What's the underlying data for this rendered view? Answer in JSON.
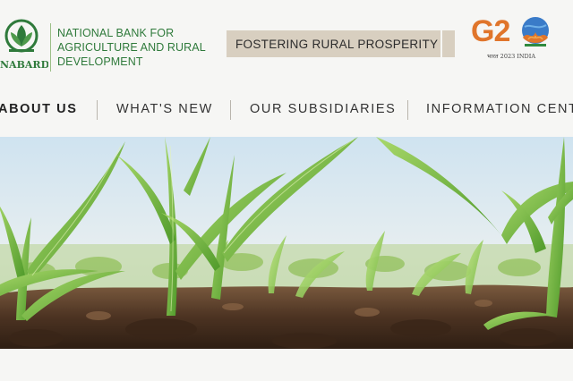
{
  "header": {
    "logo_alt": "NABARD",
    "org_name_lines": [
      "NATIONAL BANK FOR",
      "AGRICULTURE AND RURAL",
      "DEVELOPMENT"
    ],
    "tagline": "FOSTERING RURAL PROSPERITY",
    "g20": {
      "mark": "G20",
      "subtitle": "भारत 2023 INDIA"
    }
  },
  "nav": {
    "items": [
      {
        "label": "ABOUT US",
        "active": true
      },
      {
        "label": "WHAT'S NEW",
        "active": false
      },
      {
        "label": "OUR SUBSIDIARIES",
        "active": false
      },
      {
        "label": "INFORMATION CENTRE",
        "active": false
      }
    ]
  },
  "hero": {
    "image_subject": "corn-seedlings-field"
  },
  "colors": {
    "brand_green": "#2f7a3b",
    "tagline_bg": "#d8cfc0",
    "g20_orange": "#e0752b",
    "page_bg": "#f6f6f4"
  }
}
